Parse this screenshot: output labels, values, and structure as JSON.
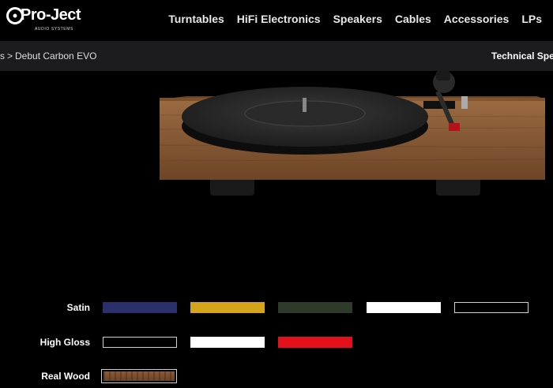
{
  "brand": {
    "name": "Pro-Ject",
    "tagline": "AUDIO SYSTEMS"
  },
  "nav": {
    "items": [
      {
        "label": "Turntables"
      },
      {
        "label": "HiFi Electronics"
      },
      {
        "label": "Speakers"
      },
      {
        "label": "Cables"
      },
      {
        "label": "Accessories"
      },
      {
        "label": "LPs"
      }
    ]
  },
  "breadcrumb": {
    "parent": "s",
    "separator": ">",
    "current": "Debut Carbon EVO"
  },
  "tech_link": "Technical Spe",
  "options": {
    "satin": {
      "label": "Satin",
      "swatches": [
        "#2b2f6b",
        "#d4a41a",
        "#2f3a2a",
        "#ffffff",
        "#000000"
      ]
    },
    "high_gloss": {
      "label": "High Gloss",
      "swatches": [
        "#000000",
        "#ffffff",
        "#e3101c"
      ]
    },
    "real_wood": {
      "label": "Real Wood",
      "swatches": [
        "walnut"
      ]
    }
  }
}
